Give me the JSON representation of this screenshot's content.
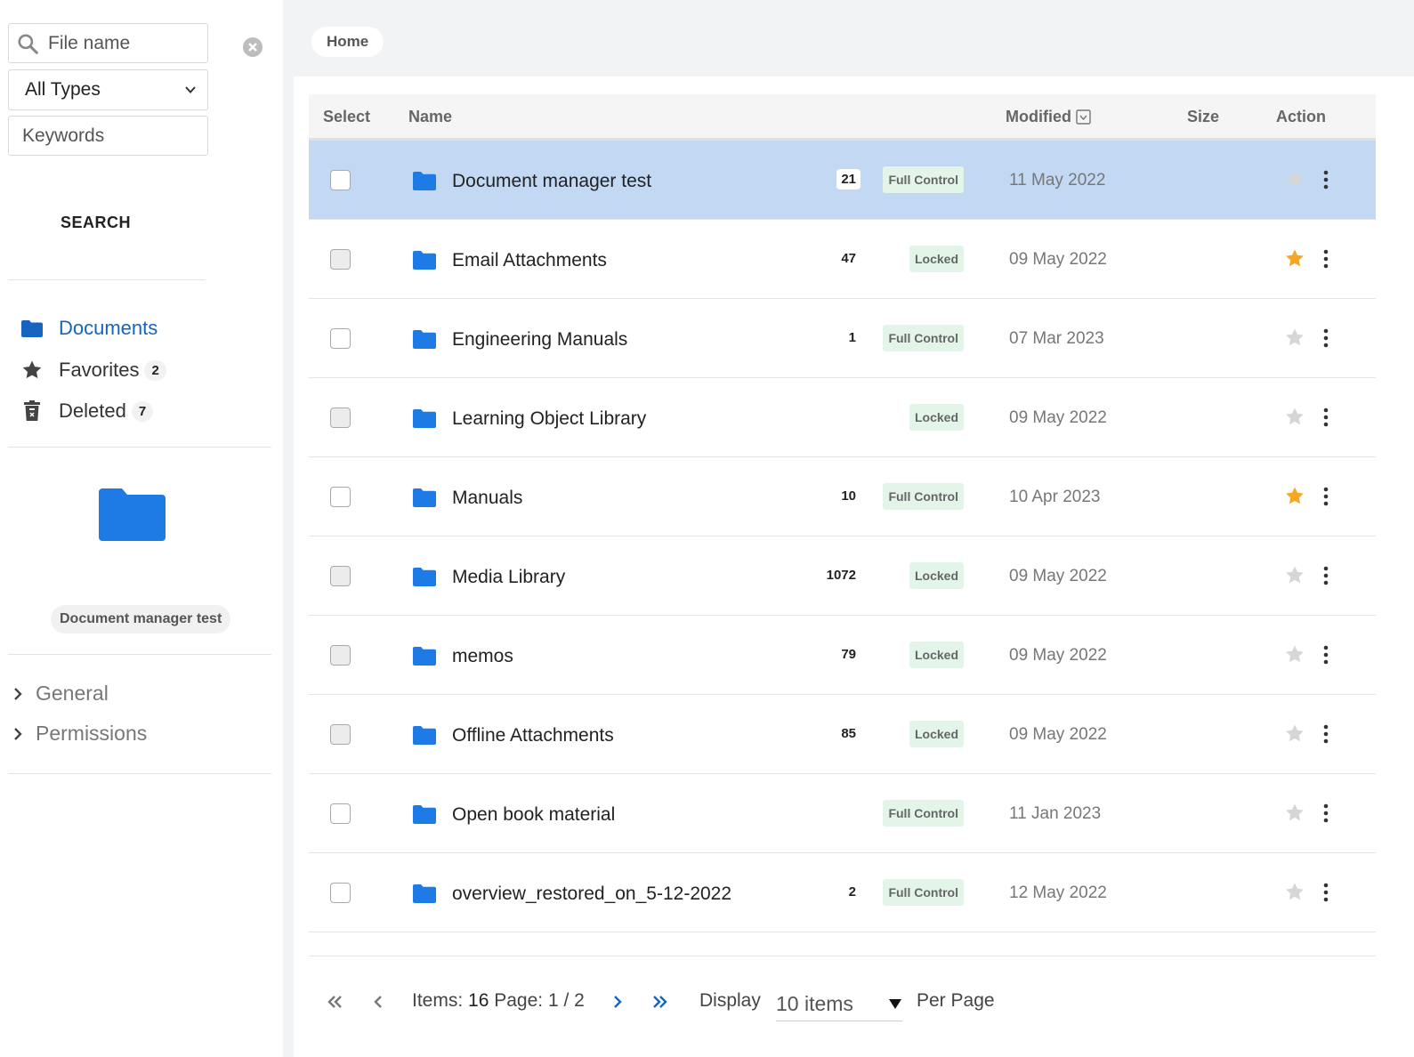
{
  "sidebar": {
    "search_placeholder": "File name",
    "type_select": "All Types",
    "keywords_placeholder": "Keywords",
    "search_button": "SEARCH",
    "nav": [
      {
        "label": "Documents",
        "icon": "folder-icon",
        "active": true
      },
      {
        "label": "Favorites",
        "icon": "star-icon",
        "badge": "2"
      },
      {
        "label": "Deleted",
        "icon": "trash-icon",
        "badge": "7"
      }
    ],
    "selected_item": "Document manager test",
    "sections": [
      "General",
      "Permissions"
    ]
  },
  "breadcrumb": "Home",
  "table": {
    "headers": {
      "select": "Select",
      "name": "Name",
      "modified": "Modified",
      "size": "Size",
      "action": "Action"
    },
    "rows": [
      {
        "name": "Document manager test",
        "count": "21",
        "perm": "Full Control",
        "date": "11 May 2022",
        "fav": false,
        "selected": true
      },
      {
        "name": "Email Attachments",
        "count": "47",
        "perm": "Locked",
        "date": "09 May 2022",
        "fav": true
      },
      {
        "name": "Engineering Manuals",
        "count": "1",
        "perm": "Full Control",
        "date": "07 Mar 2023",
        "fav": false
      },
      {
        "name": "Learning Object Library",
        "count": "",
        "perm": "Locked",
        "date": "09 May 2022",
        "fav": false
      },
      {
        "name": "Manuals",
        "count": "10",
        "perm": "Full Control",
        "date": "10 Apr 2023",
        "fav": true
      },
      {
        "name": "Media Library",
        "count": "1072",
        "perm": "Locked",
        "date": "09 May 2022",
        "fav": false
      },
      {
        "name": "memos",
        "count": "79",
        "perm": "Locked",
        "date": "09 May 2022",
        "fav": false
      },
      {
        "name": "Offline Attachments",
        "count": "85",
        "perm": "Locked",
        "date": "09 May 2022",
        "fav": false
      },
      {
        "name": "Open book material",
        "count": "",
        "perm": "Full Control",
        "date": "11 Jan 2023",
        "fav": false
      },
      {
        "name": "overview_restored_on_5-12-2022",
        "count": "2",
        "perm": "Full Control",
        "date": "12 May 2022",
        "fav": false
      }
    ]
  },
  "pager": {
    "items_label": "Items:",
    "items_count": "16",
    "page_label": "Page:",
    "page_value": "1 / 2",
    "display_label": "Display",
    "per_page_value": "10 items",
    "per_page_label": "Per Page"
  },
  "colors": {
    "accent": "#1565c0",
    "folder": "#1e7be6",
    "selected_row": "#c2d8f3",
    "star_on": "#f5a623",
    "star_off": "#d6d6d6",
    "perm_bg": "#e3f5e9"
  }
}
